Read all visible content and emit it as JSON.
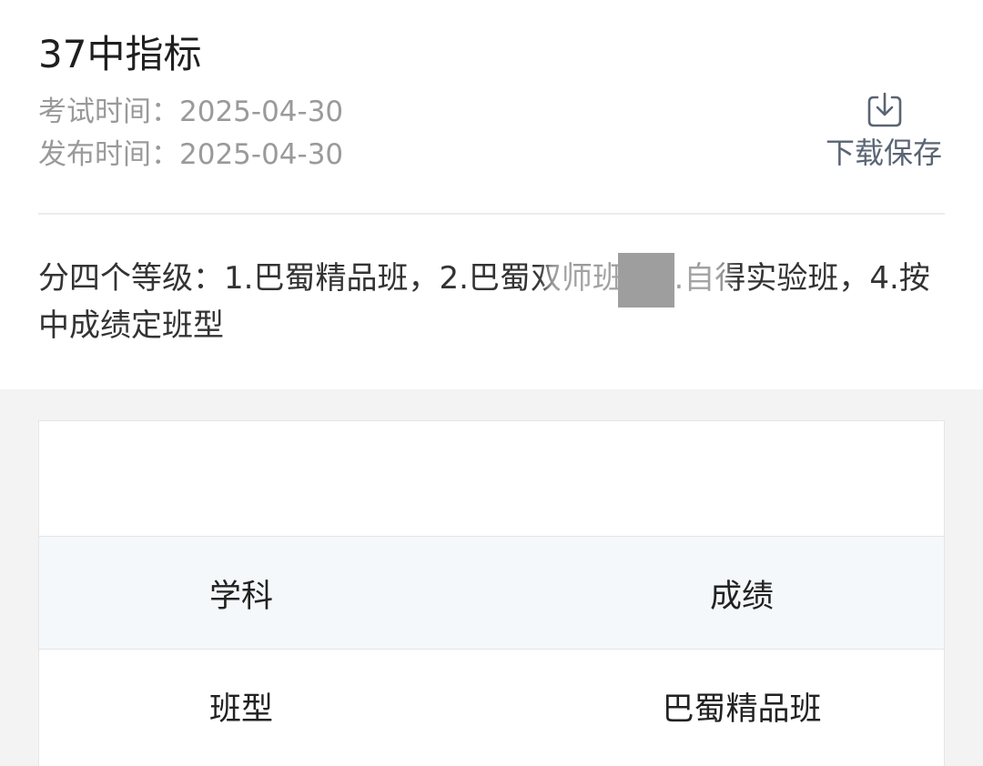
{
  "header": {
    "title": "37中指标",
    "exam_time": "考试时间：2025-04-30",
    "publish_time": "发布时间：2025-04-30",
    "download_label": "下载保存",
    "download_icon": "download-icon"
  },
  "description": "分四个等级：1.巴蜀精品班，2.巴蜀双师班，3.自得实验班，4.按中成绩定班型",
  "table": {
    "headers": [
      "学科",
      "成绩"
    ],
    "rows": [
      [
        "班型",
        "巴蜀精品班"
      ]
    ]
  },
  "colors": {
    "title": "#1f1f1f",
    "meta": "#9a9a9a",
    "accent": "#5a6473",
    "table_header_bg": "#f5f8fb",
    "page_bg": "#f3f3f3"
  }
}
